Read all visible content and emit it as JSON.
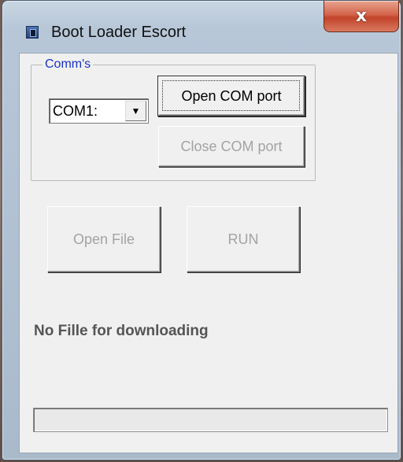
{
  "window": {
    "title": "Boot Loader Escort",
    "close_glyph": "x"
  },
  "comms": {
    "group_label": "Comm's",
    "port_selected": "COM1:",
    "open_port_label": "Open COM port",
    "close_port_label": "Close COM port"
  },
  "actions": {
    "open_file_label": "Open File",
    "run_label": "RUN"
  },
  "status": {
    "message": "No Fille for downloading"
  },
  "progress": {
    "value": 0
  }
}
